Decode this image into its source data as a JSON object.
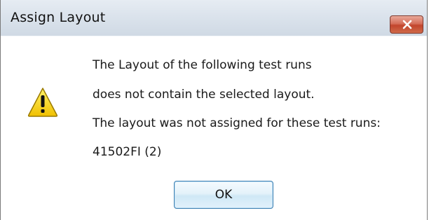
{
  "window": {
    "title": "Assign Layout",
    "close_label": "close"
  },
  "message": {
    "icon": "warning-icon",
    "lines": [
      "The Layout of the following test runs",
      "does not contain the selected layout.",
      "The layout was not assigned for these test runs:",
      "41502FI (2)"
    ]
  },
  "buttons": {
    "ok_label": "OK"
  },
  "colors": {
    "titlebar": "#dbe3ec",
    "close_button": "#c2452d",
    "warning_fill": "#f5d000",
    "ok_button_border": "#3c7fb1"
  }
}
